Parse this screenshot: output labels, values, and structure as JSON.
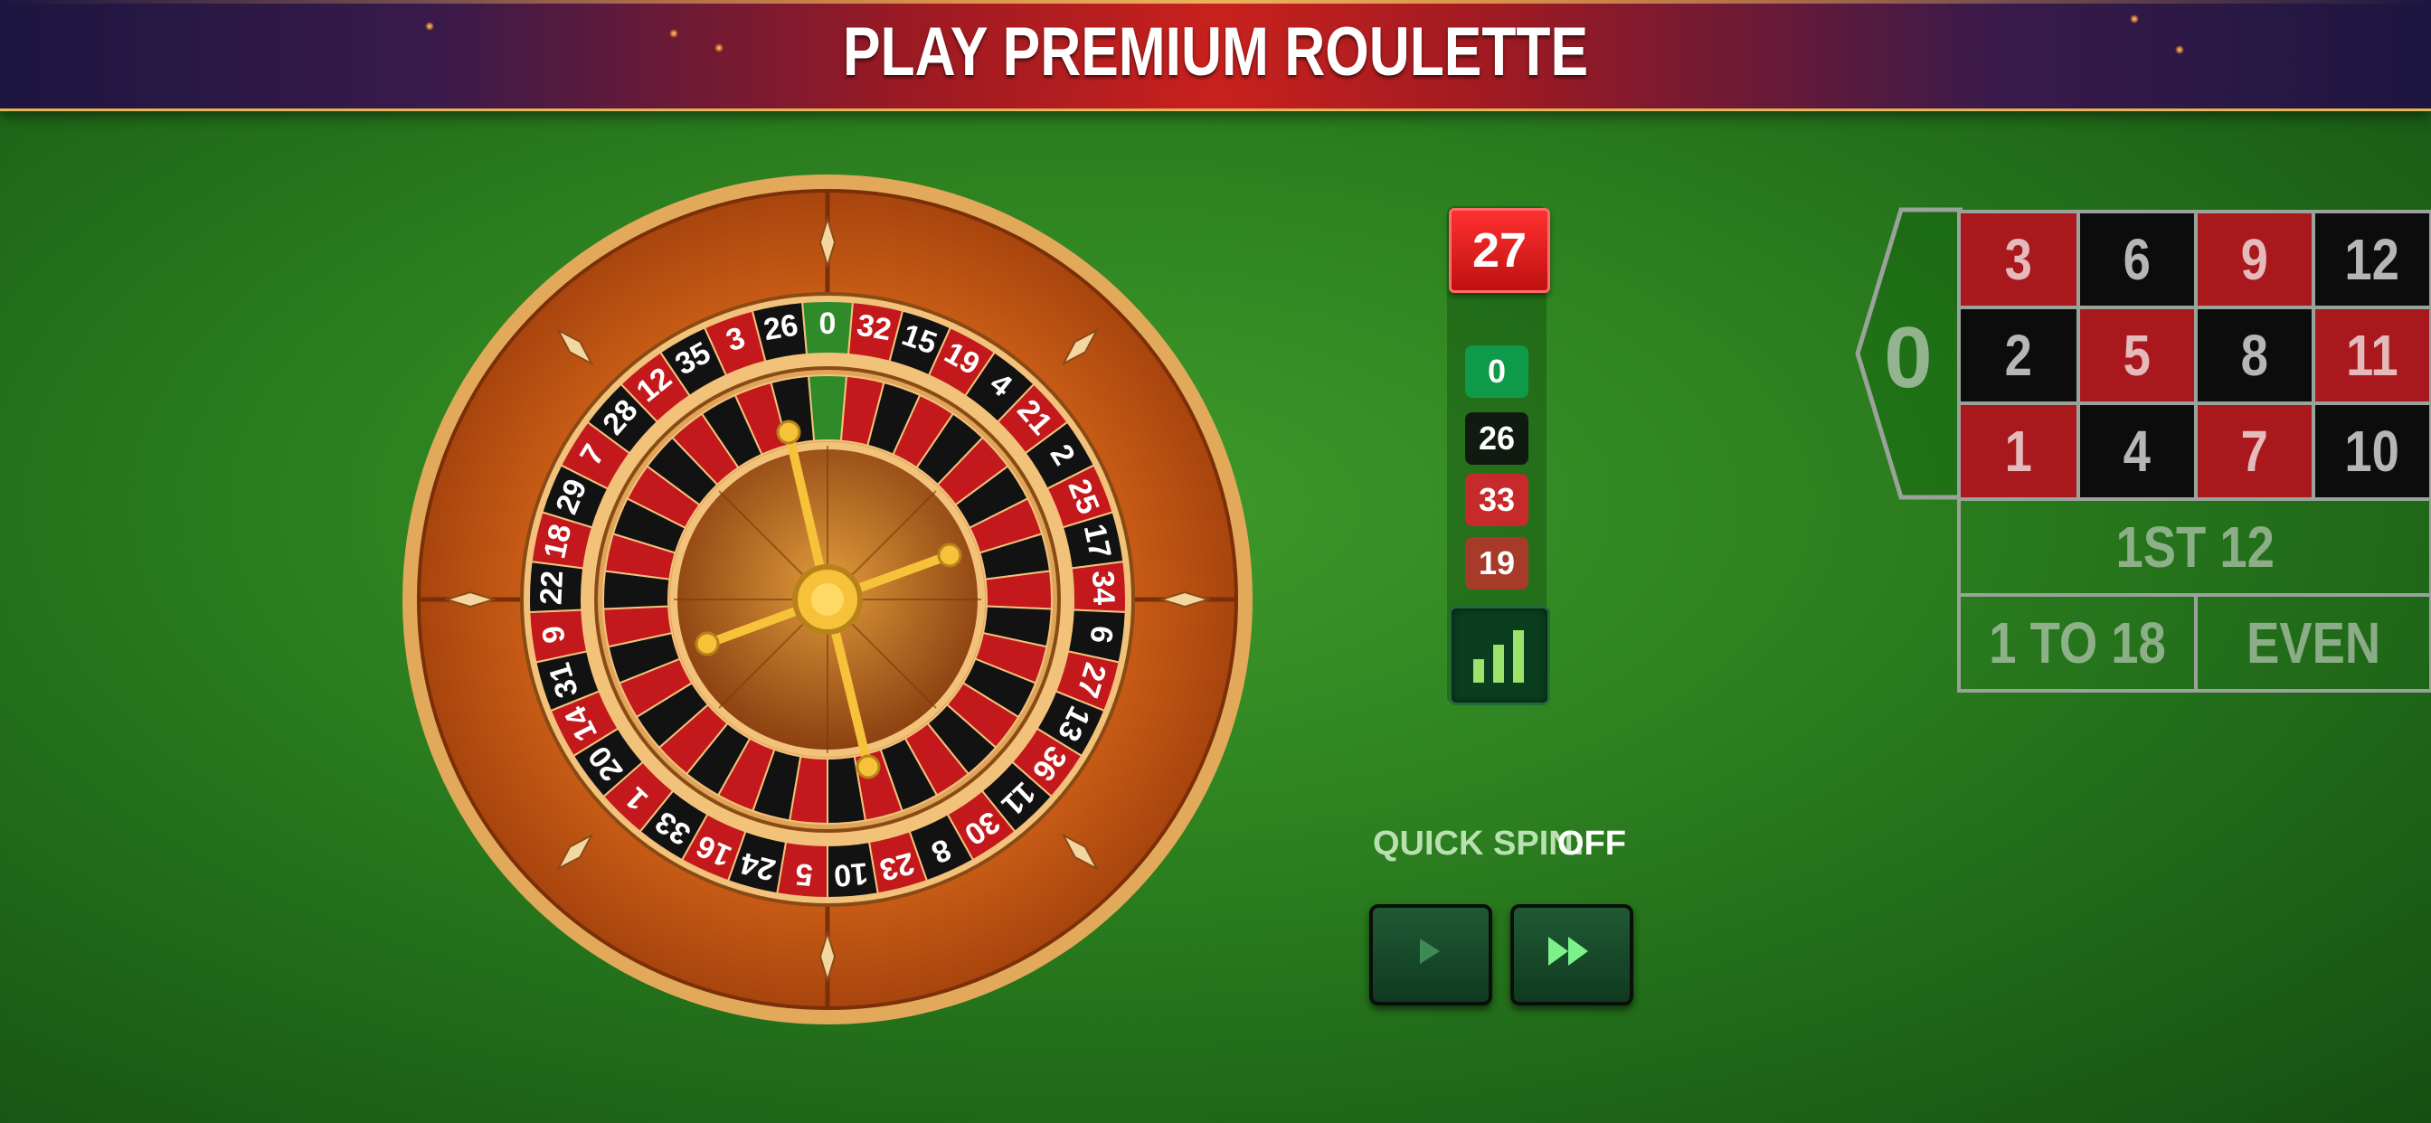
{
  "banner": {
    "title": "PLAY PREMIUM ROULETTE"
  },
  "wheel": {
    "numbers": [
      "0",
      "32",
      "15",
      "19",
      "4",
      "21",
      "2",
      "25",
      "17",
      "34",
      "6",
      "27",
      "13",
      "36",
      "11",
      "30",
      "8",
      "23",
      "10",
      "5",
      "24",
      "16",
      "33",
      "1",
      "20",
      "14",
      "31",
      "9",
      "22",
      "18",
      "29",
      "7",
      "28",
      "12",
      "35",
      "3",
      "26"
    ]
  },
  "results": {
    "last": "27",
    "history": [
      {
        "value": "0",
        "color": "#0f9a4a"
      },
      {
        "value": "26",
        "color": "#101a10"
      },
      {
        "value": "33",
        "color": "#c62a2a"
      },
      {
        "value": "19",
        "color": "#a83a2a"
      }
    ],
    "stats_icon": "bar-chart-icon"
  },
  "quick_spin": {
    "label": "QUICK SPIN:",
    "value": "OFF"
  },
  "controls": {
    "spin_icon": "play-icon",
    "fast_icon": "fast-forward-icon"
  },
  "table": {
    "zero": "0",
    "rows": [
      [
        {
          "n": "3",
          "c": "red"
        },
        {
          "n": "6",
          "c": "black"
        },
        {
          "n": "9",
          "c": "red"
        },
        {
          "n": "12",
          "c": "black"
        }
      ],
      [
        {
          "n": "2",
          "c": "black"
        },
        {
          "n": "5",
          "c": "red"
        },
        {
          "n": "8",
          "c": "black"
        },
        {
          "n": "11",
          "c": "red"
        }
      ],
      [
        {
          "n": "1",
          "c": "red"
        },
        {
          "n": "4",
          "c": "black"
        },
        {
          "n": "7",
          "c": "red"
        },
        {
          "n": "10",
          "c": "black"
        }
      ]
    ],
    "dozen": "1ST 12",
    "low": "1 TO 18",
    "even": "EVEN"
  }
}
